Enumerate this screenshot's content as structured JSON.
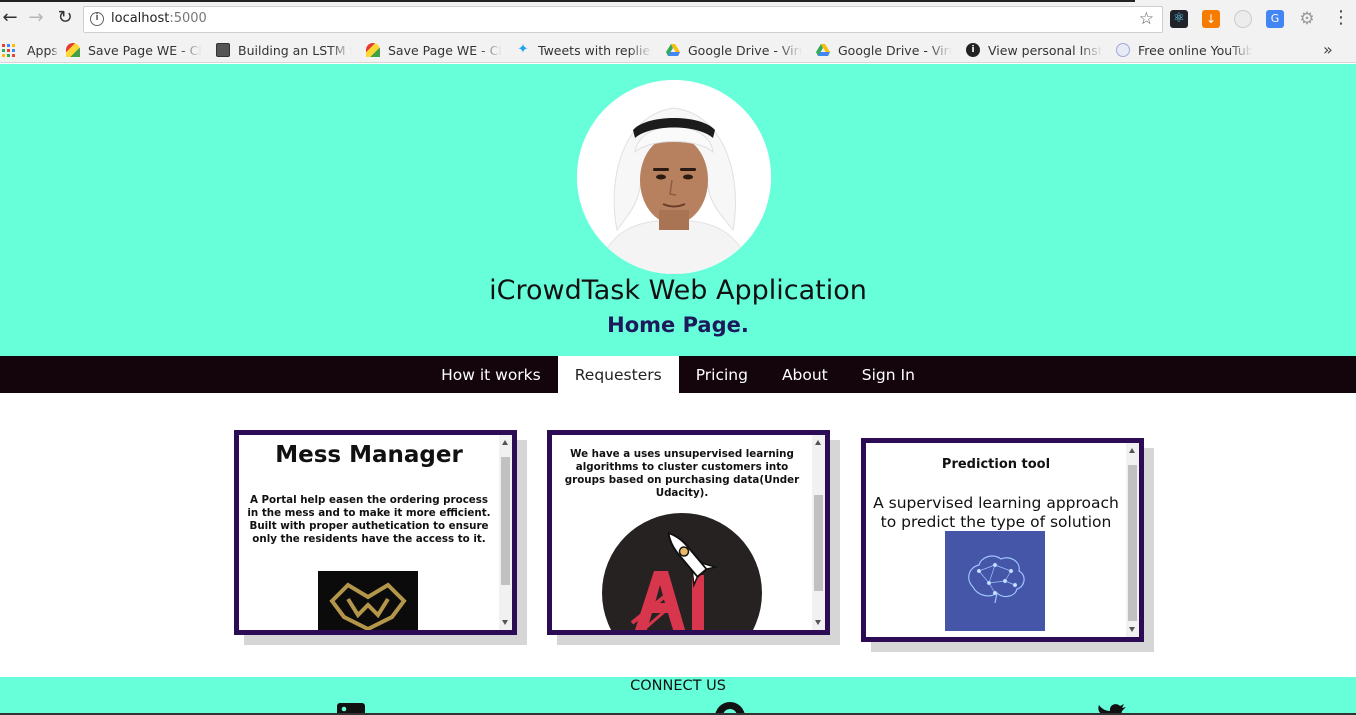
{
  "browser": {
    "url_host": "localhost",
    "url_port": ":5000",
    "bookmarks": [
      {
        "label": "Apps",
        "icon": "apps-grid-icon"
      },
      {
        "label": "Save Page WE - Chr",
        "icon": "save-page-we-icon"
      },
      {
        "label": "Building an LSTM fr",
        "icon": "document-icon"
      },
      {
        "label": "Save Page WE - Chr",
        "icon": "save-page-we-icon"
      },
      {
        "label": "Tweets with replies",
        "icon": "twitter-bird-icon"
      },
      {
        "label": "Google Drive - Virus",
        "icon": "google-drive-icon"
      },
      {
        "label": "Google Drive - Virus",
        "icon": "google-drive-icon"
      },
      {
        "label": "View personal Insta",
        "icon": "info-circle-icon"
      },
      {
        "label": "Free online YouTube",
        "icon": "youtube-converter-icon"
      }
    ]
  },
  "hero": {
    "title": "iCrowdTask Web Application",
    "subtitle": "Home Page.",
    "bg_color": "#66ffda"
  },
  "nav": {
    "items": [
      "How it works",
      "Requesters",
      "Pricing",
      "About",
      "Sign In"
    ],
    "active": "Requesters"
  },
  "cards": [
    {
      "title": "Mess Manager",
      "description": "A Portal help easen the ordering process in the mess and to make it more efficient. Built with proper authetication to ensure only the residents have the access to it.",
      "image_icon": "mess-manager-logo-icon"
    },
    {
      "description": "We have a uses unsupervised learning algorithms to cluster customers into groups based on purchasing data(Under Udacity).",
      "image_icon": "ai-rocket-logo-icon"
    },
    {
      "title": "Prediction tool",
      "description": "A supervised learning approach to predict the type of solution needed.",
      "image_icon": "brain-network-icon"
    }
  ],
  "footer": {
    "connect_label": "CONNECT US",
    "icons": [
      "linkedin-icon",
      "github-icon",
      "twitter-icon"
    ]
  },
  "colors": {
    "accent": "#66ffda",
    "card_border": "#2c0c54",
    "nav_bg": "#14040b",
    "subtitle": "#1d1a5c"
  }
}
